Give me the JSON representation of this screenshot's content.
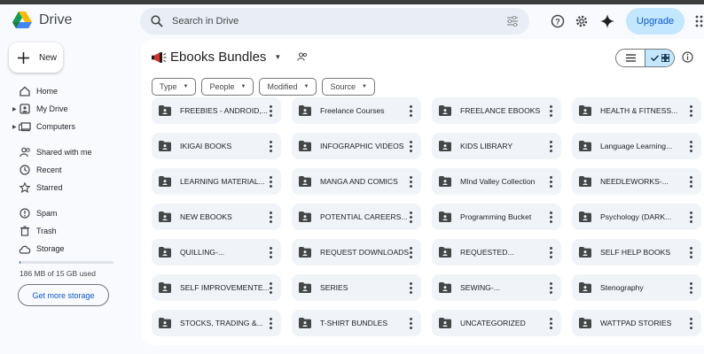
{
  "app": {
    "name": "Drive"
  },
  "search": {
    "placeholder": "Search in Drive"
  },
  "header": {
    "upgrade_label": "Upgrade"
  },
  "sidebar": {
    "new_label": "New",
    "items": [
      {
        "label": "Home",
        "icon": "home-icon"
      },
      {
        "label": "My Drive",
        "icon": "my-drive-icon"
      },
      {
        "label": "Computers",
        "icon": "computers-icon"
      },
      {
        "label": "Shared with me",
        "icon": "shared-icon"
      },
      {
        "label": "Recent",
        "icon": "clock-icon"
      },
      {
        "label": "Starred",
        "icon": "star-icon"
      },
      {
        "label": "Spam",
        "icon": "spam-icon"
      },
      {
        "label": "Trash",
        "icon": "trash-icon"
      },
      {
        "label": "Storage",
        "icon": "cloud-icon"
      }
    ],
    "storage_used_text": "186 MB of 15 GB used",
    "storage_fraction": 0.012,
    "get_more_storage_label": "Get more storage"
  },
  "main": {
    "folder_title": "Ebooks Bundles",
    "filters": [
      "Type",
      "People",
      "Modified",
      "Source"
    ],
    "folders": [
      [
        "FREEBIES - ANDROID,...",
        "Freelance Courses",
        "FREELANCE EBOOKS",
        "HEALTH & FITNESS..."
      ],
      [
        "IKIGAI BOOKS",
        "INFOGRAPHIC VIDEOS",
        "KIDS LIBRARY",
        "Language Learning..."
      ],
      [
        "LEARNING MATERIAL...",
        "MANGA AND COMICS",
        "MInd Valley Collection",
        "NEEDLEWORKS-..."
      ],
      [
        "NEW EBOOKS",
        "POTENTIAL CAREERS...",
        "Programming Bucket",
        "Psychology (DARK..."
      ],
      [
        "QUILLING-...",
        "REQUEST DOWNLOADS",
        "REQUESTED...",
        "SELF HELP BOOKS"
      ],
      [
        "SELF IMPROVEMENTE...",
        "SERIES",
        "SEWING-...",
        "Stenography"
      ],
      [
        "STOCKS, TRADING &...",
        "T-SHIRT BUNDLES",
        "UNCATEGORIZED",
        "WATTPAD STORIES"
      ]
    ]
  },
  "colors": {
    "accent": "#0b57d0",
    "selected": "#c2e7ff",
    "folder_bg": "#f0f4f9",
    "page_bg": "#f8fafd"
  }
}
